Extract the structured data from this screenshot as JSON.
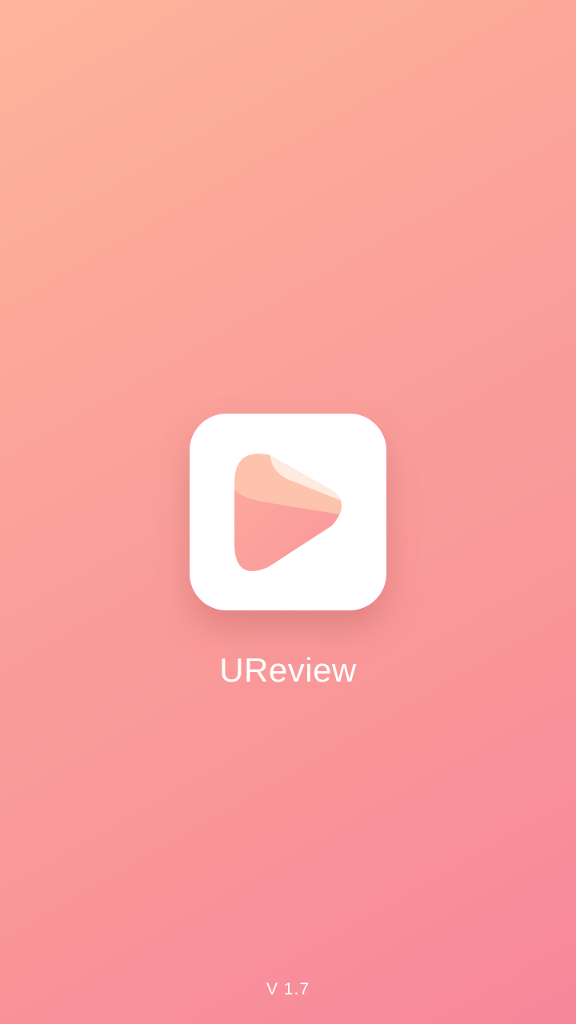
{
  "app": {
    "name": "UReview",
    "version": "V 1.7",
    "icon": "play-logo-icon"
  },
  "colors": {
    "gradient_start": "#feb59b",
    "gradient_end": "#f7879b"
  }
}
